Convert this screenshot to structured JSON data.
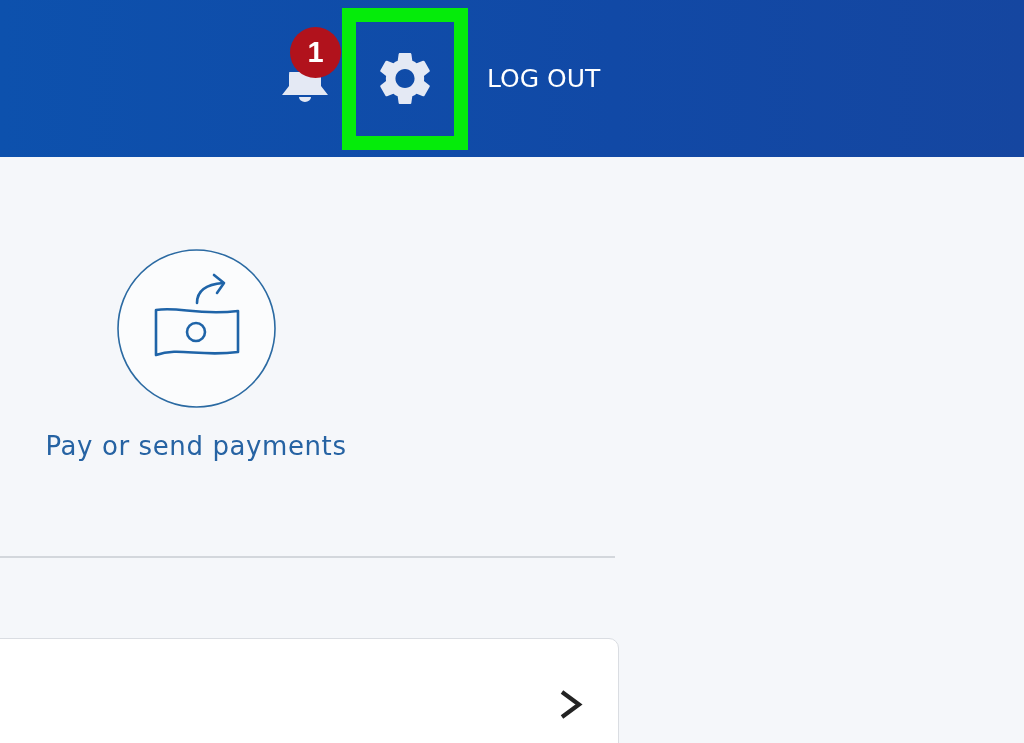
{
  "header": {
    "notifications": {
      "badge": "1"
    },
    "settings": {
      "highlighted": true
    },
    "logout": "LOG OUT"
  },
  "actions": [
    {
      "label": "Pay or send payments"
    }
  ]
}
